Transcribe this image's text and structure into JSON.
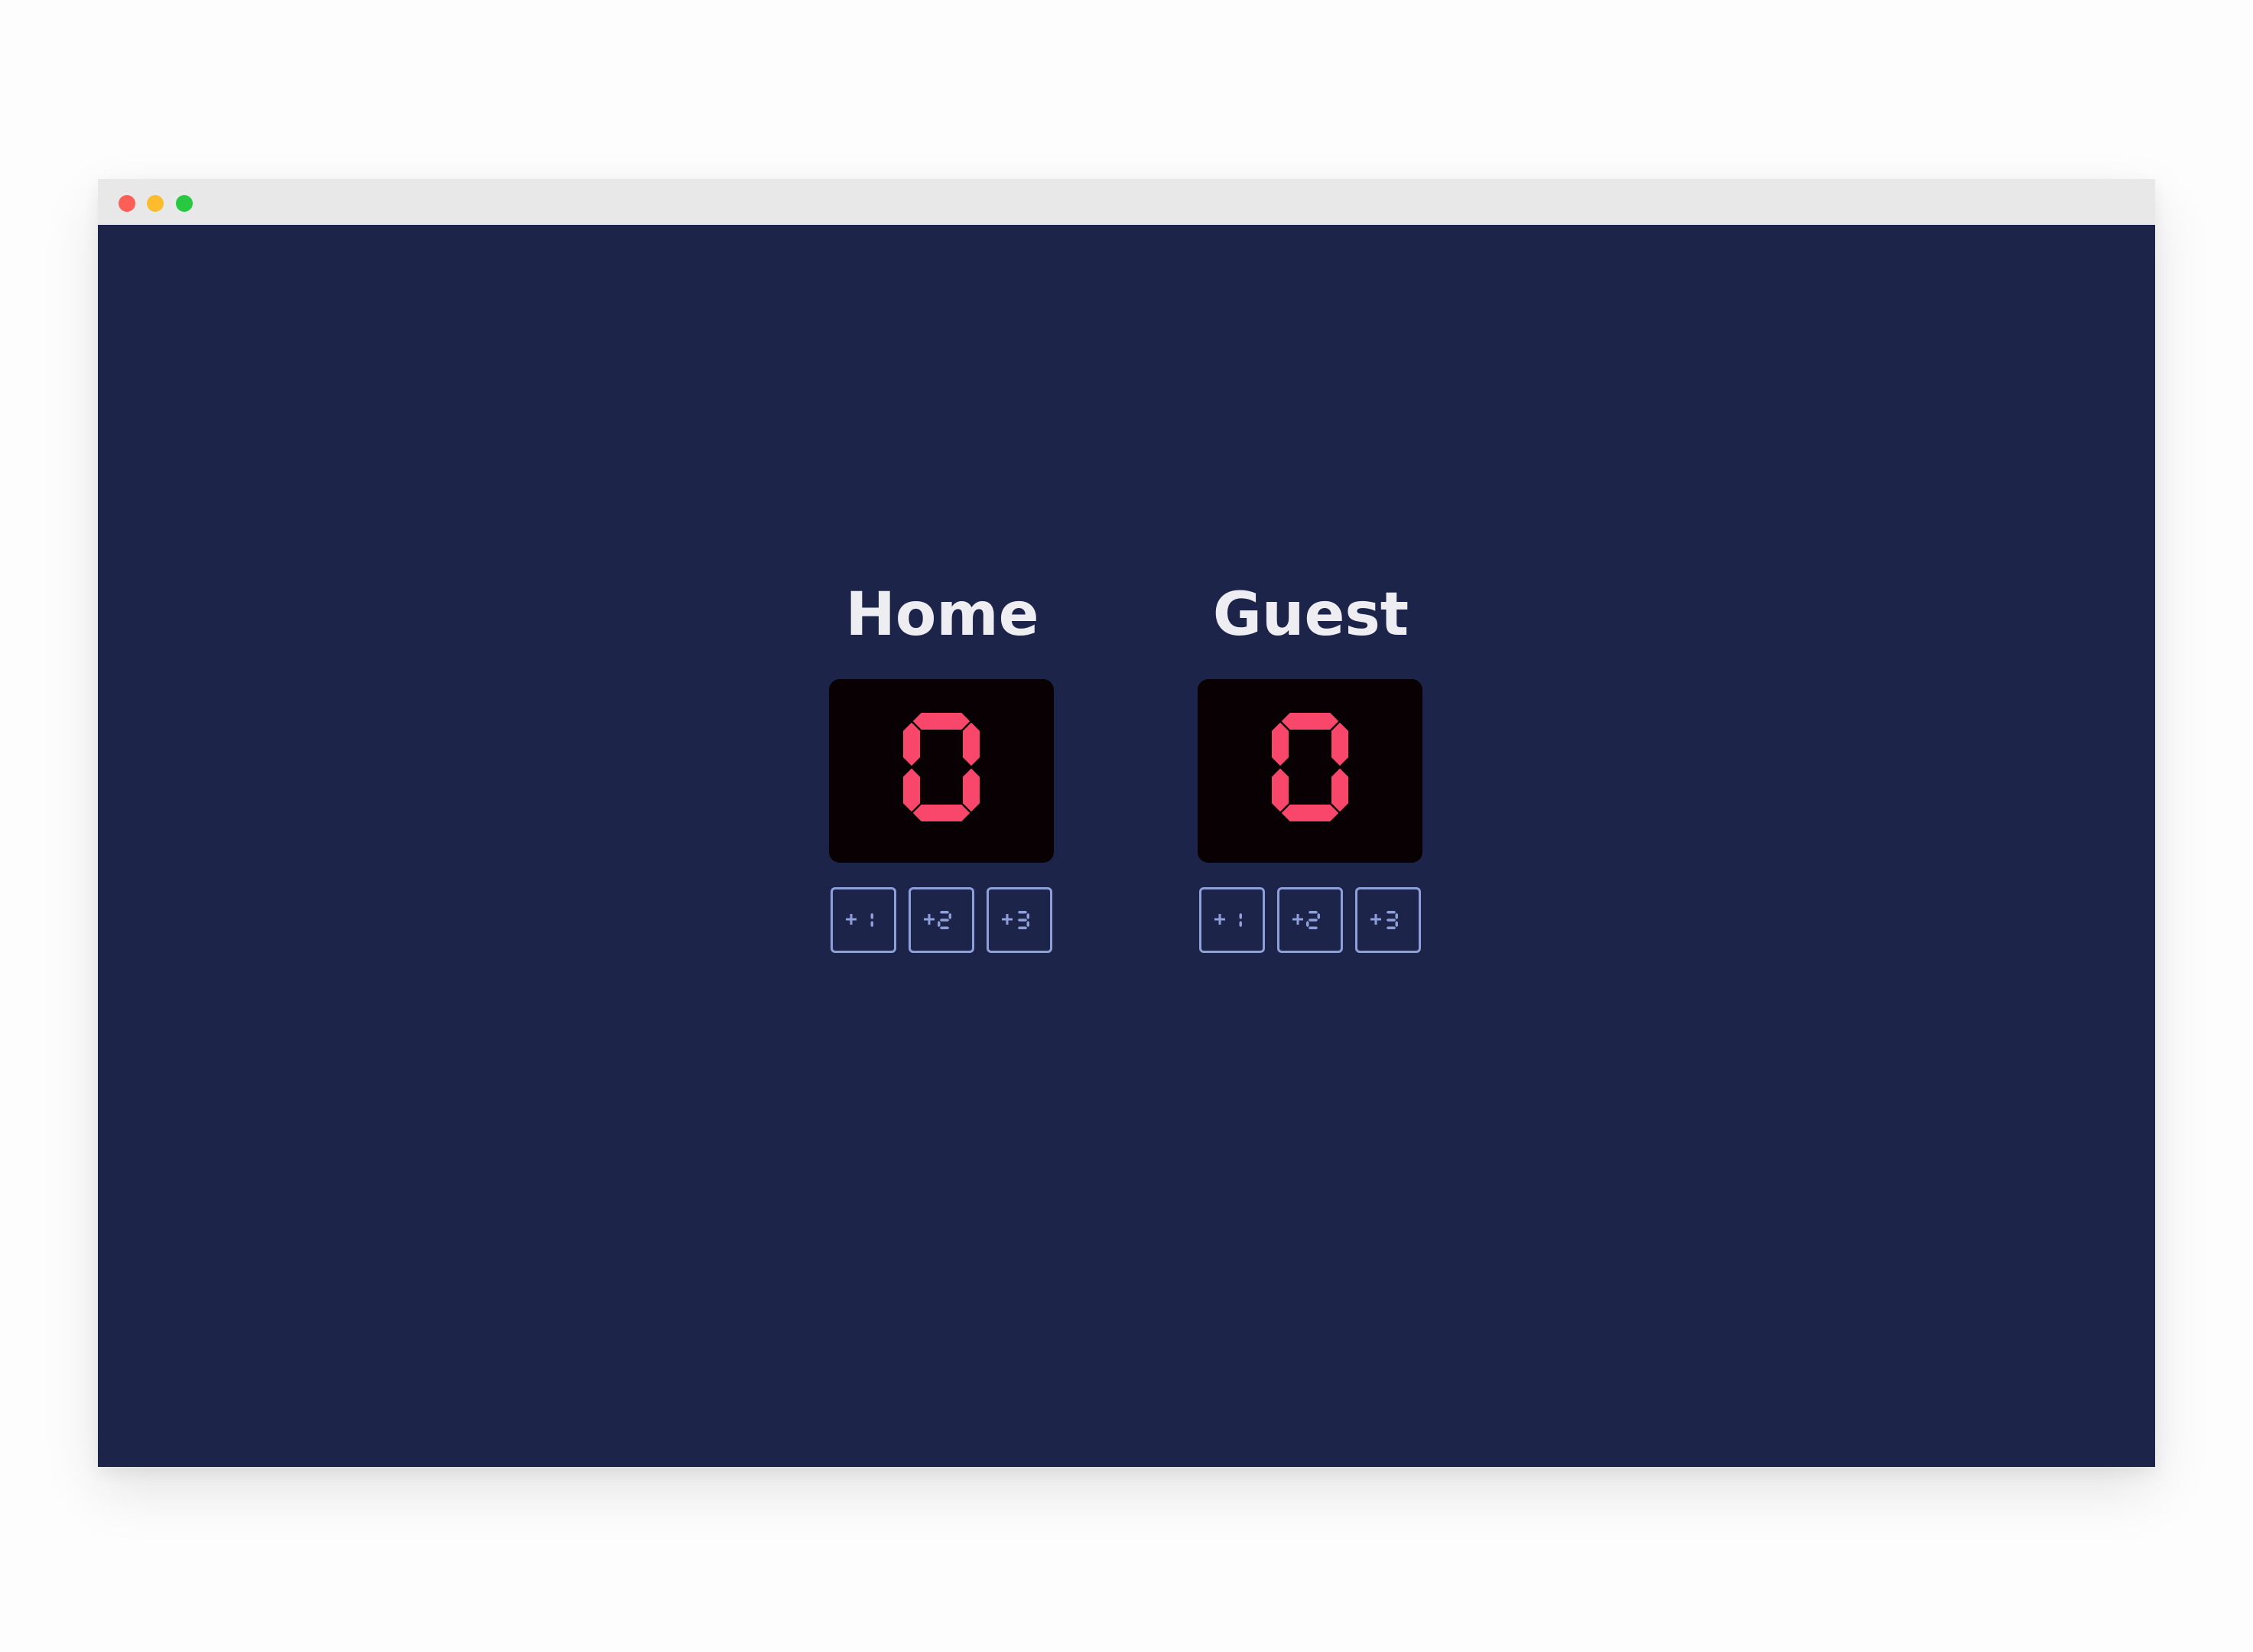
{
  "colors": {
    "page_bg": "#fdfdfd",
    "app_bg": "#1c2449",
    "titlebar_bg": "#e8e8e8",
    "traffic_close": "#fc5f57",
    "traffic_minimize": "#fdbc2e",
    "traffic_maximize": "#28c840",
    "team_name": "#eeeef2",
    "score_box_bg": "#080002",
    "score_digit": "#f8476b",
    "button_border": "#8f9fd9",
    "button_text": "#8f9fd9"
  },
  "window": {
    "traffic_lights": [
      "close-icon",
      "minimize-icon",
      "maximize-icon"
    ]
  },
  "teams": [
    {
      "name": "Home",
      "score": "0",
      "buttons": [
        {
          "label": "+1"
        },
        {
          "label": "+2"
        },
        {
          "label": "+3"
        }
      ]
    },
    {
      "name": "Guest",
      "score": "0",
      "buttons": [
        {
          "label": "+1"
        },
        {
          "label": "+2"
        },
        {
          "label": "+3"
        }
      ]
    }
  ]
}
